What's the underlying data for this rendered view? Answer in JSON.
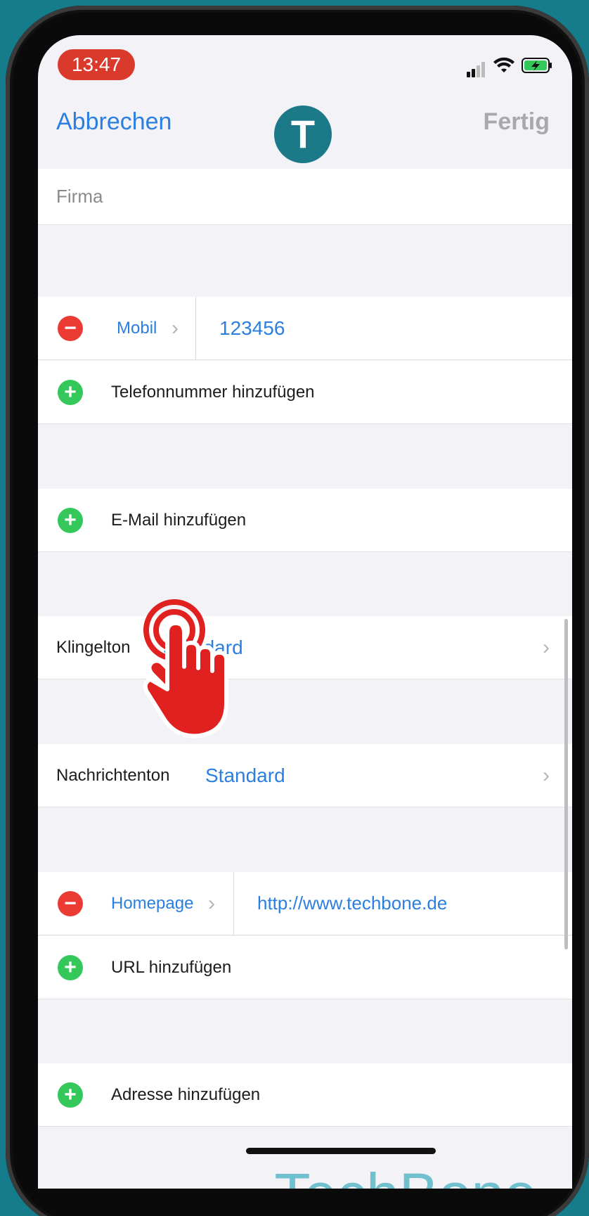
{
  "status": {
    "time": "13:47"
  },
  "nav": {
    "cancel": "Abbrechen",
    "avatar_letter": "T",
    "done": "Fertig"
  },
  "company": {
    "placeholder": "Firma"
  },
  "phone": {
    "label": "Mobil",
    "value": "123456",
    "add": "Telefonnummer hinzufügen"
  },
  "email": {
    "add": "E-Mail hinzufügen"
  },
  "ringtone": {
    "label": "Klingelton",
    "value": "Standard"
  },
  "message_tone": {
    "label": "Nachrichtenton",
    "value": "Standard"
  },
  "url": {
    "label": "Homepage",
    "value": "http://www.techbone.de",
    "add": "URL hinzufügen"
  },
  "address": {
    "add": "Adresse hinzufügen"
  },
  "watermark": "TechBone",
  "colors": {
    "accent": "#2b7fe0",
    "remove": "#ec3b32",
    "add": "#34c759",
    "background": "#157c8c"
  }
}
